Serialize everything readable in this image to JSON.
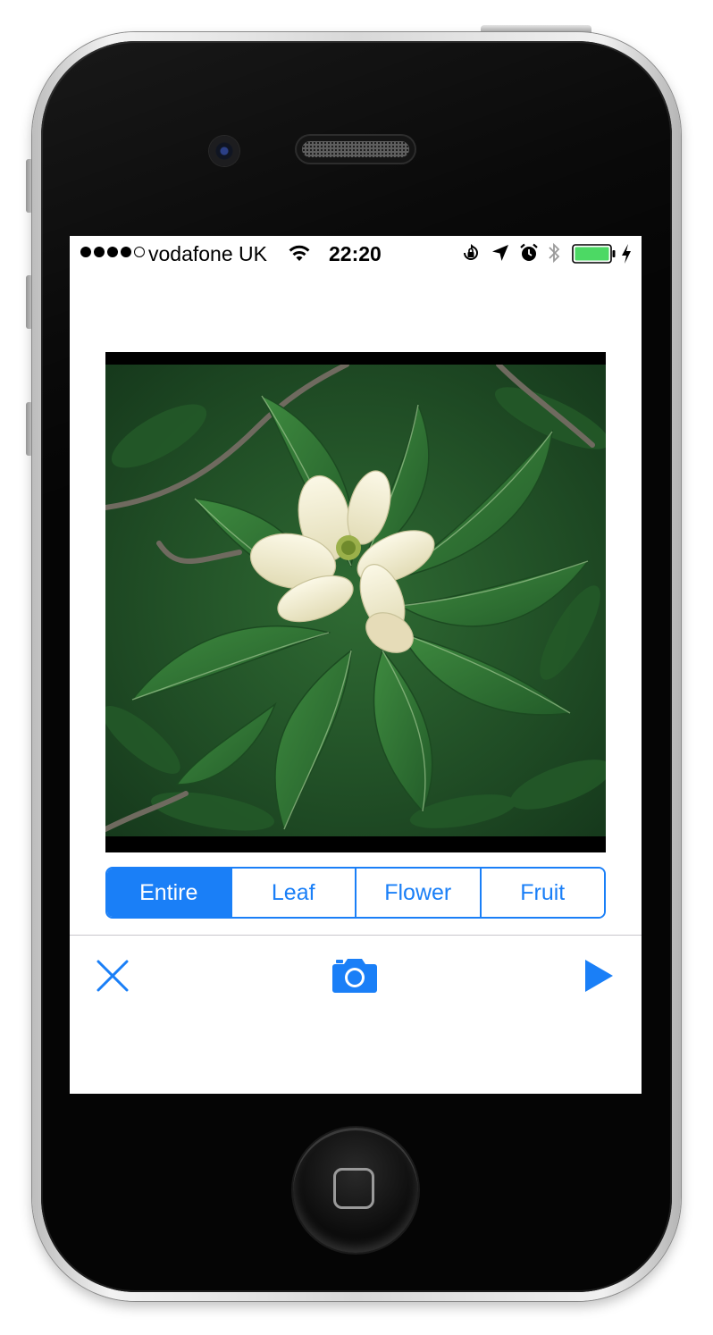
{
  "status_bar": {
    "carrier": "vodafone UK",
    "time": "22:20",
    "signal_bars_filled": 4,
    "signal_bars_total": 5,
    "battery_color": "#4cd964",
    "icons": [
      "wifi-icon",
      "rotation-lock-icon",
      "location-arrow-icon",
      "alarm-icon",
      "bluetooth-icon",
      "battery-icon",
      "charging-bolt-icon"
    ]
  },
  "photo": {
    "subject": "white magnolia flower with green leaves"
  },
  "segments": {
    "selected": "Entire",
    "items": [
      "Entire",
      "Leaf",
      "Flower",
      "Fruit"
    ]
  },
  "toolbar": {
    "icons": [
      "close-icon",
      "camera-icon",
      "play-icon"
    ]
  },
  "colors": {
    "accent": "#1a7ff7",
    "divider": "#c8c7cc"
  }
}
